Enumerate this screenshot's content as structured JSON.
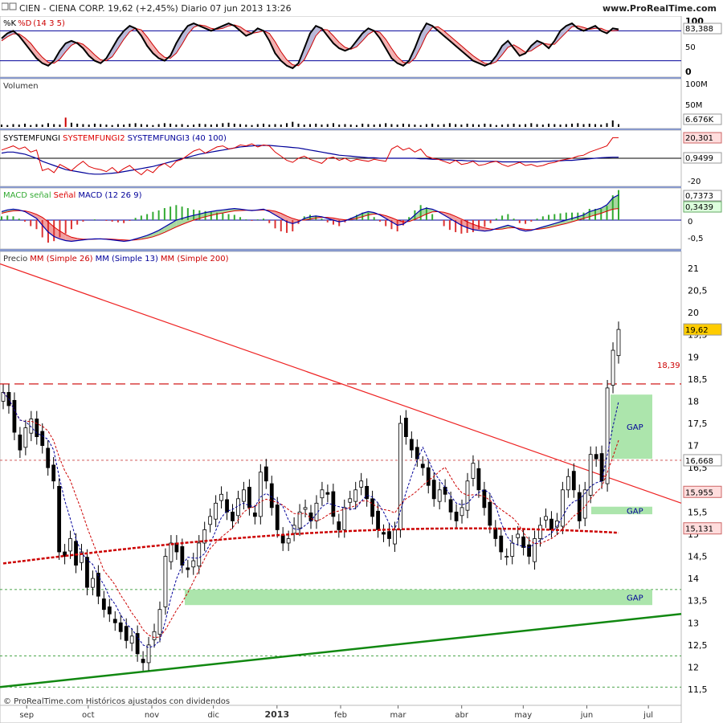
{
  "header": {
    "title": "CIEN - CIENA CORP.     19,62 (+2,45%)     Diario  07 jun 2013 13:26",
    "url": "www.ProRealTime.com"
  },
  "footer": {
    "copyright": "© ProRealTime.com Históricos ajustados con dividendos"
  },
  "colors": {
    "k_line": "#000000",
    "d_line": "#cc0000",
    "volume": "#000000",
    "sf1": "#000000",
    "sf2": "#dd0000",
    "sf3": "#000099",
    "macd_fill_up": "#a8d8a0",
    "macd_fill_dn": "#f0a0a0",
    "macd_line": "#0000aa",
    "signal_line": "#dd0000",
    "hist_up": "#33aa33",
    "hist_dn": "#dd3333",
    "mm26": "#cc0000",
    "mm13": "#000099",
    "mm200": "#cc0000",
    "trend_down": "#ee2222",
    "trend_up": "#118811",
    "gap_fill": "#9ee09e",
    "price_badge": "#ffcc00",
    "label_red": "#ffdddd",
    "label_green": "#ddffdd"
  },
  "chart_data": [
    {
      "type": "line",
      "panel": "stochastic",
      "title": "%K %D (14 3 5)",
      "title_parts": [
        "%K",
        "%D",
        "(14 3 5)"
      ],
      "ylim": [
        0,
        100
      ],
      "y_ticks": [
        "100",
        "50",
        "0"
      ],
      "levels": [
        80,
        20
      ],
      "last_value": "83,388",
      "series": [
        {
          "name": "%K",
          "values": [
            65,
            75,
            80,
            70,
            55,
            40,
            25,
            15,
            10,
            20,
            40,
            55,
            60,
            55,
            45,
            30,
            20,
            15,
            25,
            45,
            65,
            80,
            90,
            85,
            70,
            50,
            35,
            25,
            20,
            30,
            55,
            75,
            90,
            95,
            90,
            85,
            80,
            85,
            90,
            95,
            90,
            80,
            70,
            75,
            85,
            80,
            60,
            35,
            20,
            10,
            5,
            15,
            45,
            75,
            90,
            85,
            70,
            55,
            45,
            40,
            45,
            60,
            75,
            85,
            80,
            65,
            45,
            25,
            15,
            10,
            20,
            45,
            75,
            95,
            90,
            80,
            70,
            60,
            50,
            40,
            30,
            20,
            15,
            10,
            15,
            30,
            50,
            60,
            45,
            30,
            35,
            50,
            60,
            55,
            45,
            60,
            80,
            90,
            95,
            85,
            80,
            85,
            90,
            80,
            75,
            85,
            83
          ]
        },
        {
          "name": "%D",
          "values": [
            60,
            68,
            74,
            74,
            66,
            55,
            40,
            27,
            17,
            15,
            23,
            38,
            51,
            57,
            53,
            43,
            32,
            22,
            20,
            28,
            45,
            63,
            78,
            85,
            82,
            68,
            52,
            37,
            27,
            25,
            35,
            53,
            73,
            87,
            92,
            90,
            85,
            83,
            85,
            90,
            92,
            88,
            80,
            75,
            77,
            80,
            75,
            58,
            38,
            22,
            12,
            10,
            22,
            45,
            70,
            83,
            82,
            70,
            57,
            47,
            43,
            48,
            60,
            73,
            80,
            77,
            63,
            45,
            28,
            17,
            15,
            25,
            47,
            72,
            87,
            88,
            80,
            70,
            60,
            50,
            40,
            30,
            22,
            15,
            13,
            18,
            32,
            47,
            52,
            45,
            37,
            40,
            48,
            55,
            53,
            53,
            65,
            77,
            88,
            90,
            87,
            83,
            85,
            85,
            80,
            80,
            81
          ]
        }
      ]
    },
    {
      "type": "bar",
      "panel": "volume",
      "title": "Volumen",
      "y_ticks": [
        "100M",
        "50M"
      ],
      "last_value": "6.676K",
      "values": [
        5,
        4,
        6,
        5,
        7,
        4,
        6,
        5,
        8,
        6,
        5,
        20,
        9,
        7,
        6,
        5,
        7,
        6,
        5,
        4,
        6,
        5,
        7,
        8,
        6,
        5,
        4,
        6,
        8,
        7,
        5,
        6,
        4,
        5,
        7,
        6,
        5,
        6,
        8,
        9,
        7,
        6,
        5,
        4,
        6,
        7,
        5,
        6,
        5,
        8,
        11,
        7,
        5,
        6,
        7,
        5,
        6,
        8,
        5,
        6,
        5,
        4,
        7,
        6,
        5,
        6,
        8,
        6,
        5,
        7,
        6,
        5,
        4,
        6,
        7,
        5,
        6,
        8,
        6,
        5,
        7,
        6,
        5,
        7,
        6,
        4,
        5,
        6,
        7,
        5,
        6,
        8,
        6,
        5,
        7,
        6,
        5,
        6,
        7,
        8,
        6,
        7,
        6,
        5,
        8,
        14,
        6
      ]
    },
    {
      "type": "line",
      "panel": "systemfungi",
      "title": "SYSTEMFUNGI SYSTEMFUNGI2 SYSTEMFUNGI3 (40 100)",
      "title_parts": [
        "SYSTEMFUNGI",
        "SYSTEMFUNGI2",
        "SYSTEMFUNGI3",
        "(40 100)"
      ],
      "y_ticks": [
        "-20"
      ],
      "last_value_a": "20,301",
      "last_value_b": "0,9499",
      "ylim": [
        -25,
        25
      ],
      "zero_level": 0,
      "series": [
        {
          "name": "SYSTEMFUNGI2",
          "values": [
            8,
            10,
            12,
            9,
            11,
            6,
            8,
            -12,
            -10,
            -14,
            -6,
            -9,
            -12,
            -7,
            -3,
            -8,
            -10,
            -11,
            -13,
            -9,
            -14,
            -10,
            -7,
            -12,
            -16,
            -11,
            -14,
            -8,
            -5,
            -9,
            -3,
            -1,
            3,
            7,
            9,
            5,
            8,
            11,
            12,
            9,
            10,
            13,
            12,
            14,
            11,
            13,
            12,
            6,
            2,
            -2,
            -4,
            0,
            2,
            -1,
            -3,
            -5,
            0,
            1,
            -2,
            0,
            -3,
            -1,
            -2,
            -3,
            -1,
            -2,
            -3,
            9,
            12,
            8,
            10,
            6,
            9,
            2,
            0,
            -1,
            -3,
            -5,
            -2,
            -6,
            -5,
            -3,
            -7,
            -6,
            -4,
            -3,
            -6,
            -8,
            -6,
            -4,
            -7,
            -6,
            -8,
            -7,
            -5,
            -4,
            -2,
            -1,
            0,
            2,
            3,
            6,
            8,
            10,
            12,
            20,
            20
          ]
        },
        {
          "name": "SYSTEMFUNGI3",
          "values": [
            5,
            6,
            6,
            5,
            4,
            2,
            0,
            -3,
            -5,
            -7,
            -9,
            -11,
            -12,
            -13,
            -14,
            -15,
            -15.5,
            -15.5,
            -15,
            -14.5,
            -14,
            -13,
            -12,
            -11,
            -10,
            -9,
            -8,
            -6.5,
            -5,
            -3.5,
            -2,
            -0.5,
            1,
            2.5,
            4,
            5,
            6,
            7,
            8,
            9,
            10,
            11,
            11.5,
            12,
            12.5,
            12.5,
            12.5,
            12,
            11.5,
            11,
            10.5,
            10,
            9,
            8,
            7,
            6,
            5,
            4,
            3,
            2.5,
            2,
            1.5,
            1,
            0.5,
            0.5,
            0,
            0,
            0,
            0,
            0,
            0,
            0,
            -0.5,
            -0.5,
            -1,
            -1,
            -1.5,
            -1.5,
            -2,
            -2,
            -2.5,
            -2.5,
            -3,
            -3,
            -3,
            -3,
            -3.5,
            -3.5,
            -3.5,
            -3.5,
            -3.5,
            -3.5,
            -3.5,
            -3,
            -3,
            -2.5,
            -2.5,
            -2,
            -2,
            -1.5,
            -1,
            -0.5,
            0,
            0.5,
            0.8,
            1,
            1
          ]
        }
      ]
    },
    {
      "type": "line",
      "panel": "macd",
      "title": "MACD señal Señal MACD (12 26 9)",
      "title_parts": [
        "MACD",
        "señal",
        "Señal",
        "MACD (12 26 9)"
      ],
      "y_ticks": [
        "0",
        "-0,5"
      ],
      "last_value_a": "0,7373",
      "last_value_b": "0,3439",
      "ylim": [
        -0.75,
        0.8
      ],
      "series": [
        {
          "name": "MACD",
          "values": [
            0.25,
            0.3,
            0.32,
            0.3,
            0.25,
            0.15,
            0.05,
            -0.15,
            -0.35,
            -0.48,
            -0.55,
            -0.6,
            -0.62,
            -0.6,
            -0.58,
            -0.56,
            -0.55,
            -0.55,
            -0.56,
            -0.58,
            -0.6,
            -0.62,
            -0.6,
            -0.55,
            -0.5,
            -0.45,
            -0.38,
            -0.3,
            -0.2,
            -0.1,
            0,
            0.05,
            0.1,
            0.14,
            0.18,
            0.22,
            0.25,
            0.28,
            0.3,
            0.32,
            0.34,
            0.32,
            0.3,
            0.28,
            0.3,
            0.32,
            0.25,
            0.15,
            0.05,
            -0.05,
            -0.1,
            -0.05,
            0.05,
            0.1,
            0.12,
            0.1,
            0.05,
            0,
            -0.05,
            -0.02,
            0.05,
            0.12,
            0.2,
            0.25,
            0.22,
            0.15,
            0.05,
            -0.05,
            -0.15,
            -0.12,
            0,
            0.15,
            0.3,
            0.35,
            0.32,
            0.25,
            0.15,
            0.05,
            -0.05,
            -0.15,
            -0.22,
            -0.28,
            -0.3,
            -0.32,
            -0.3,
            -0.25,
            -0.2,
            -0.15,
            -0.2,
            -0.28,
            -0.32,
            -0.3,
            -0.25,
            -0.2,
            -0.15,
            -0.1,
            -0.05,
            0,
            0.05,
            0.1,
            0.15,
            0.25,
            0.3,
            0.35,
            0.45,
            0.65,
            0.74
          ]
        },
        {
          "name": "Señal",
          "values": [
            0.2,
            0.24,
            0.27,
            0.28,
            0.27,
            0.23,
            0.17,
            0.08,
            -0.05,
            -0.2,
            -0.32,
            -0.42,
            -0.5,
            -0.54,
            -0.56,
            -0.56,
            -0.56,
            -0.55,
            -0.55,
            -0.56,
            -0.57,
            -0.58,
            -0.59,
            -0.58,
            -0.56,
            -0.53,
            -0.49,
            -0.43,
            -0.36,
            -0.28,
            -0.2,
            -0.13,
            -0.06,
            0,
            0.05,
            0.1,
            0.14,
            0.18,
            0.21,
            0.24,
            0.27,
            0.28,
            0.29,
            0.29,
            0.29,
            0.3,
            0.29,
            0.26,
            0.2,
            0.12,
            0.05,
            0,
            0,
            0.03,
            0.06,
            0.08,
            0.08,
            0.06,
            0.03,
            0.01,
            0.02,
            0.05,
            0.1,
            0.15,
            0.18,
            0.17,
            0.13,
            0.07,
            0,
            -0.05,
            -0.04,
            0.02,
            0.1,
            0.18,
            0.24,
            0.25,
            0.23,
            0.18,
            0.11,
            0.03,
            -0.05,
            -0.12,
            -0.18,
            -0.23,
            -0.26,
            -0.27,
            -0.26,
            -0.23,
            -0.22,
            -0.24,
            -0.27,
            -0.28,
            -0.27,
            -0.25,
            -0.22,
            -0.18,
            -0.14,
            -0.1,
            -0.05,
            0,
            0.05,
            0.1,
            0.15,
            0.2,
            0.26,
            0.32,
            0.34
          ]
        }
      ]
    },
    {
      "type": "candlestick",
      "panel": "price",
      "title": "Precio MM (Simple 26) MM (Simple 13) MM (Simple 200)",
      "title_parts": [
        "Precio",
        "MM (Simple 26)",
        "MM (Simple 13)",
        "MM (Simple 200)"
      ],
      "ylim": [
        11.3,
        21.3
      ],
      "y_ticks": [
        "21",
        "20,5",
        "20",
        "19,5",
        "19",
        "18,5",
        "18",
        "17,5",
        "17",
        "16,5",
        "16",
        "15,5",
        "15",
        "14,5",
        "14",
        "13,5",
        "13",
        "12,5",
        "12",
        "11,5"
      ],
      "x_labels": [
        "sep",
        "oct",
        "nov",
        "dic",
        "2013",
        "feb",
        "mar",
        "abr",
        "may",
        "jun",
        "jul"
      ],
      "x_label_days": [
        14,
        44,
        75,
        105,
        136,
        167,
        195,
        226,
        256,
        287,
        317
      ],
      "badges": [
        {
          "label": "19,62",
          "value": 19.62,
          "style": "yellow"
        },
        {
          "label": "16,668",
          "value": 16.668,
          "style": "white"
        },
        {
          "label": "15,955",
          "value": 15.955,
          "style": "red"
        },
        {
          "label": "15,131",
          "value": 15.131,
          "style": "red"
        }
      ],
      "resistance": {
        "label": "18,39",
        "value": 18.39
      },
      "gaps": [
        {
          "label": "GAP",
          "low": 16.7,
          "high": 18.15
        },
        {
          "label": "GAP",
          "low": 15.45,
          "high": 15.62
        },
        {
          "label": "GAP",
          "low": 13.4,
          "high": 13.75
        }
      ],
      "close": [
        18.2,
        17.9,
        17.3,
        16.9,
        17.4,
        17.6,
        17.2,
        17.0,
        16.5,
        16.2,
        14.6,
        14.5,
        14.9,
        14.3,
        14.6,
        13.8,
        14.0,
        13.6,
        13.3,
        13.2,
        13.0,
        12.8,
        12.6,
        12.7,
        12.3,
        12.1,
        12.5,
        12.8,
        13.3,
        14.5,
        14.8,
        14.6,
        14.3,
        14.2,
        14.4,
        14.8,
        15.1,
        15.4,
        15.7,
        15.9,
        15.5,
        15.3,
        15.8,
        16.0,
        15.6,
        15.4,
        16.4,
        16.2,
        15.6,
        15.1,
        14.8,
        14.9,
        15.2,
        15.5,
        15.6,
        15.3,
        15.7,
        16.0,
        15.9,
        15.4,
        15.1,
        15.6,
        15.8,
        16.0,
        16.2,
        15.8,
        15.4,
        15.1,
        15.0,
        14.9,
        15.1,
        17.5,
        17.2,
        16.9,
        16.7,
        16.5,
        16.1,
        15.8,
        16.0,
        15.9,
        15.5,
        15.3,
        15.6,
        16.2,
        16.6,
        16.0,
        15.6,
        15.2,
        14.9,
        14.6,
        14.5,
        14.8,
        15.0,
        14.7,
        14.5,
        14.9,
        15.2,
        15.4,
        15.1,
        15.3,
        16.0,
        16.3,
        16.0,
        15.3,
        16.0,
        16.8,
        16.7,
        16.2,
        18.3,
        19.15,
        19.62
      ],
      "mm200_start": 14.2,
      "mm200_end": 15.13
    }
  ]
}
